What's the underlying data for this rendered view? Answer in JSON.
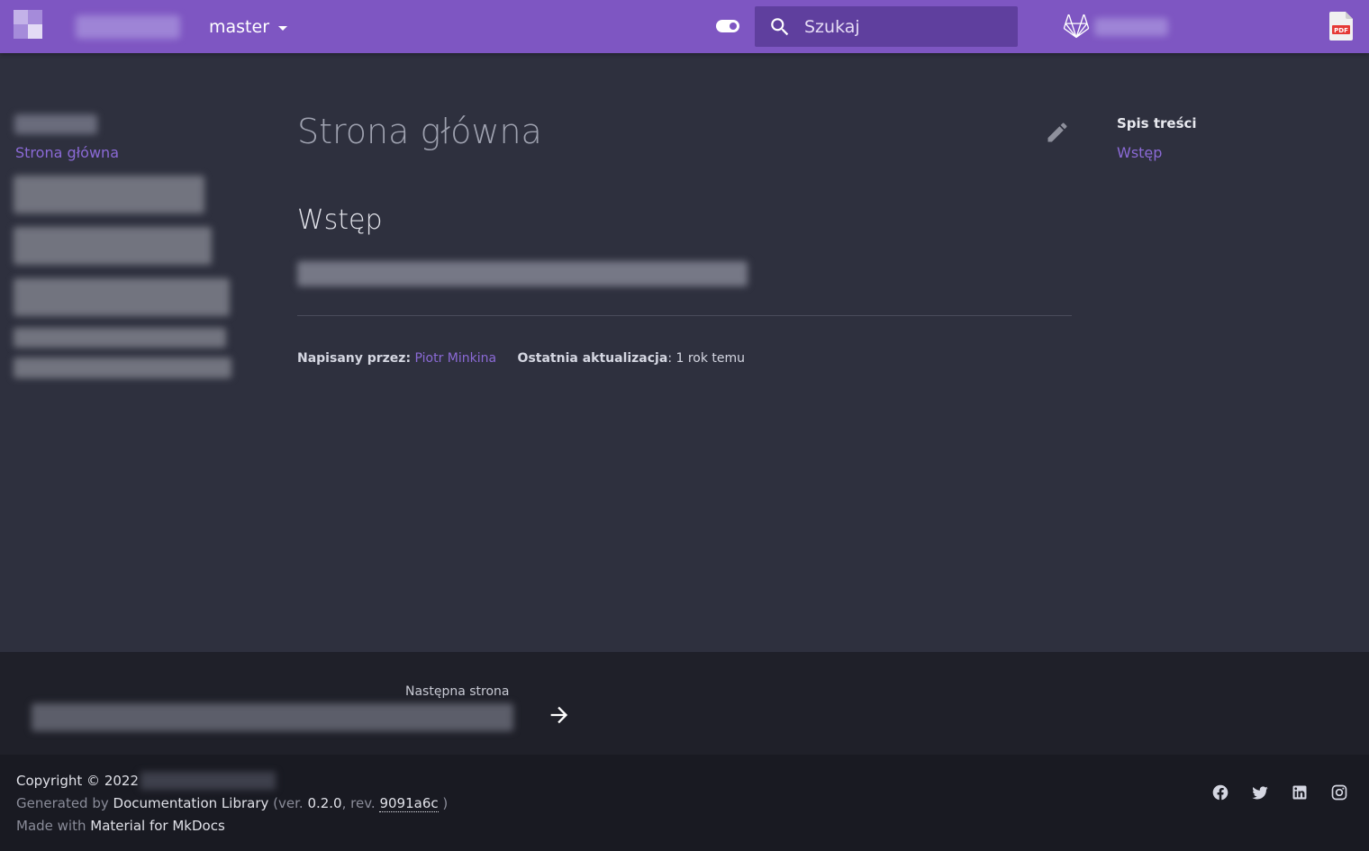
{
  "header": {
    "version_label": "master",
    "search_placeholder": "Szukaj"
  },
  "sidebar": {
    "active_item": "Strona główna"
  },
  "main": {
    "title": "Strona główna",
    "section_heading": "Wstęp",
    "author_label": "Napisany przez:",
    "author_name": "Piotr Minkina",
    "updated_label": "Ostatnia aktualizacja",
    "updated_value": ": 1 rok temu"
  },
  "toc": {
    "title": "Spis treści",
    "items": [
      "Wstęp"
    ]
  },
  "footer": {
    "next_label": "Następna strona",
    "copyright": "Copyright © 2022",
    "generated_prefix": "Generated by ",
    "generator": "Documentation Library",
    "ver_prefix": " (ver. ",
    "version": "0.2.0",
    "rev_prefix": ", rev. ",
    "revision": "9091a6c",
    "rev_suffix": " )",
    "made_prefix": "Made with ",
    "made_link": "Material for MkDocs"
  },
  "icons": {
    "logo": "logo-icon",
    "toggle": "theme-toggle-icon",
    "search": "search-icon",
    "gitlab": "gitlab-icon",
    "pdf": "pdf-icon",
    "edit": "pencil-icon",
    "next": "arrow-right-icon",
    "social": [
      "facebook-icon",
      "twitter-icon",
      "linkedin-icon",
      "instagram-icon"
    ]
  },
  "colors": {
    "accent": "#7e56c2",
    "link": "#8b6ad6",
    "background": "#2e303e"
  }
}
